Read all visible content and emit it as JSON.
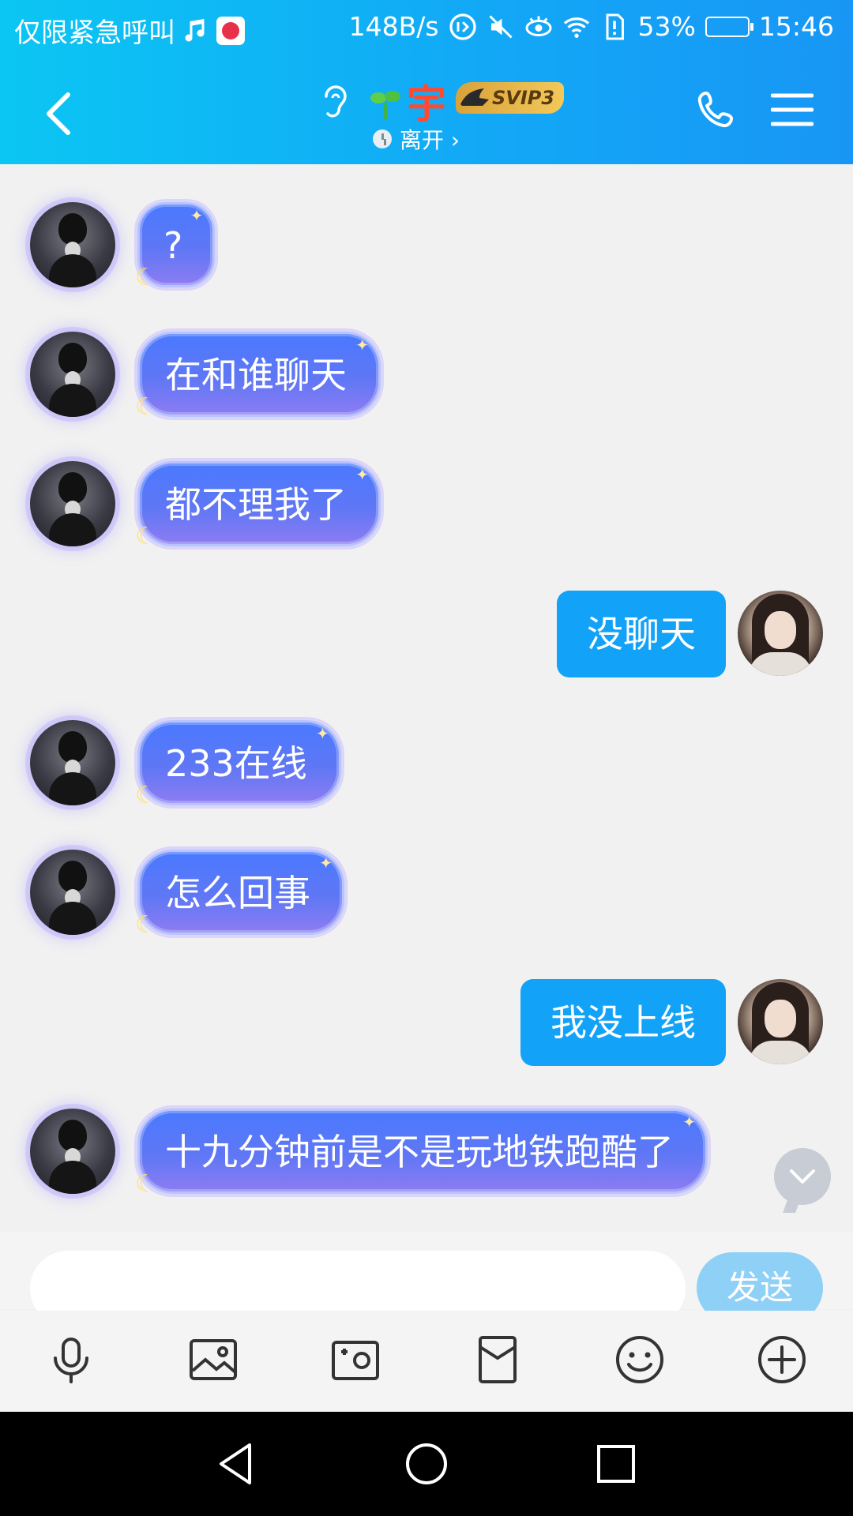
{
  "status_bar": {
    "carrier": "仅限紧急呼叫",
    "net_speed": "148B/s",
    "battery": "53%",
    "battery_level": 0.53,
    "time": "15:46"
  },
  "header": {
    "contact_name": "宇",
    "vip_badge": "SVIP3",
    "status": "离开 ›"
  },
  "messages": [
    {
      "side": "in",
      "text": "?"
    },
    {
      "side": "in",
      "text": "在和谁聊天"
    },
    {
      "side": "in",
      "text": "都不理我了"
    },
    {
      "side": "out",
      "text": "没聊天"
    },
    {
      "side": "in",
      "text": "233在线"
    },
    {
      "side": "in",
      "text": "怎么回事"
    },
    {
      "side": "out",
      "text": "我没上线"
    },
    {
      "side": "in",
      "text": "十九分钟前是不是玩地铁跑酷了"
    }
  ],
  "composer": {
    "input_value": "",
    "send_label": "发送"
  },
  "toolbar_icons": [
    "microphone-icon",
    "image-icon",
    "camera-icon",
    "red-packet-icon",
    "emoji-icon",
    "plus-icon"
  ],
  "colors": {
    "header_start": "#0bc6f3",
    "header_end": "#1896f5",
    "outgoing_bubble": "#12a2f7",
    "incoming_bubble": "#5f77f5",
    "send_button": "#8fd0f7",
    "name_color": "#ff4a32"
  }
}
